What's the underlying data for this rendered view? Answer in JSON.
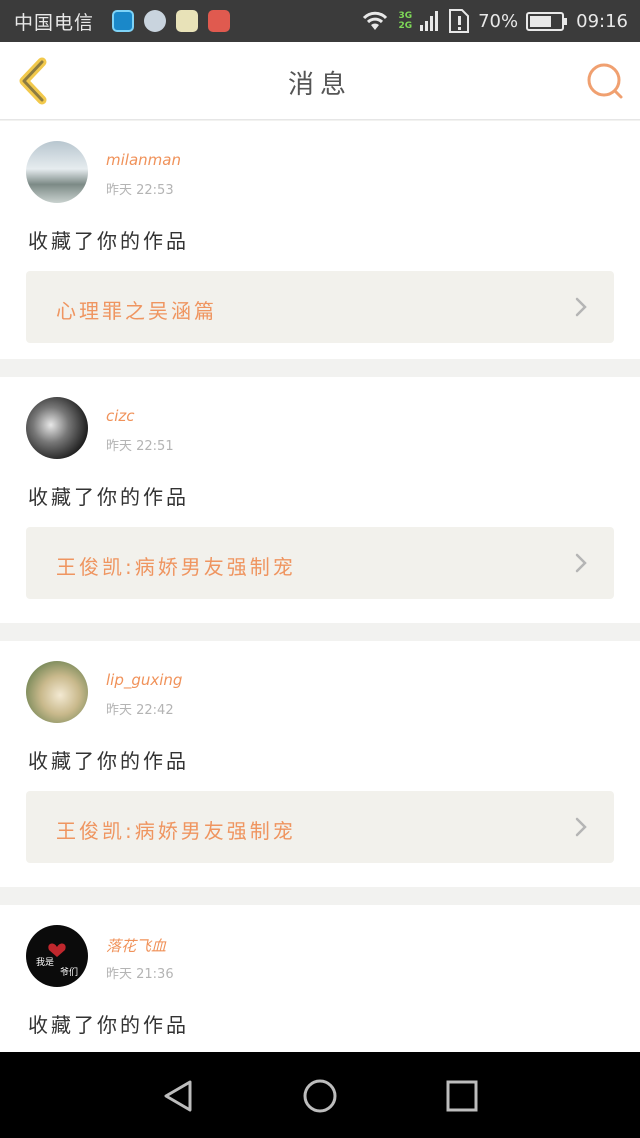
{
  "status_bar": {
    "carrier": "中国电信",
    "network": [
      "3G",
      "2G"
    ],
    "battery": "70%",
    "battery_level": 0.7,
    "time": "09:16"
  },
  "header": {
    "title": "消息",
    "back_icon": "chevron-left-icon",
    "search_icon": "search-icon"
  },
  "messages": [
    {
      "username": "milanman",
      "time": "昨天 22:53",
      "action": "收藏了你的作品",
      "work_title": "心理罪之吴涵篇"
    },
    {
      "username": "cizc",
      "time": "昨天 22:51",
      "action": "收藏了你的作品",
      "work_title": "王俊凯:病娇男友强制宠"
    },
    {
      "username": "lip_guxing",
      "time": "昨天 22:42",
      "action": "收藏了你的作品",
      "work_title": "王俊凯:病娇男友强制宠"
    },
    {
      "username": "落花飞血",
      "time": "昨天 21:36",
      "action": "收藏了你的作品",
      "work_title": ""
    }
  ],
  "avatar_text": [
    "我是",
    "爷们"
  ],
  "colors": {
    "accent": "#f0925a",
    "back": "#f2c94c",
    "card_bg": "#f2f1ec"
  }
}
